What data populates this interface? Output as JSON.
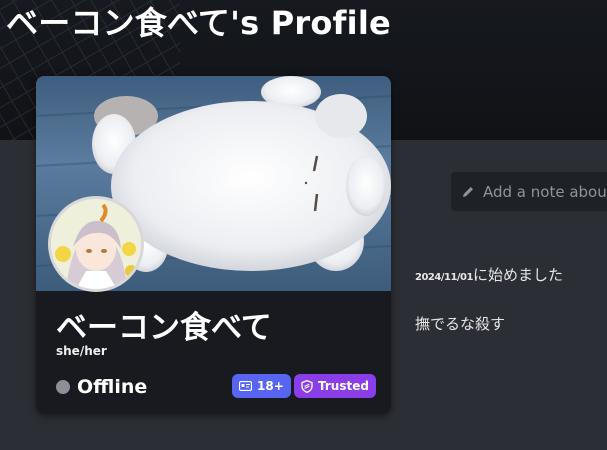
{
  "page": {
    "title": "ベーコン食べて's Profile"
  },
  "profile": {
    "display_name": "ベーコン食べて",
    "pronouns": "she/her",
    "status": "Offline",
    "status_color": "#8a8f98",
    "banner_icon": "fluffy-animal-banner",
    "avatar_icon": "anime-avatar"
  },
  "badges": {
    "age": {
      "label": "18+",
      "icon": "id-card-icon",
      "color": "#5865f2"
    },
    "trusted": {
      "label": "Trusted",
      "icon": "shield-icon",
      "color": "#8a3ee8"
    }
  },
  "note": {
    "placeholder": "Add a note about",
    "icon": "pencil-icon"
  },
  "bio": {
    "date": "2024/11/01",
    "line1_text": "に始めました",
    "line2": "撫でるな殺す"
  },
  "colors": {
    "background": "#0e1014",
    "panel": "#2b2e34",
    "card": "#181a1f"
  }
}
